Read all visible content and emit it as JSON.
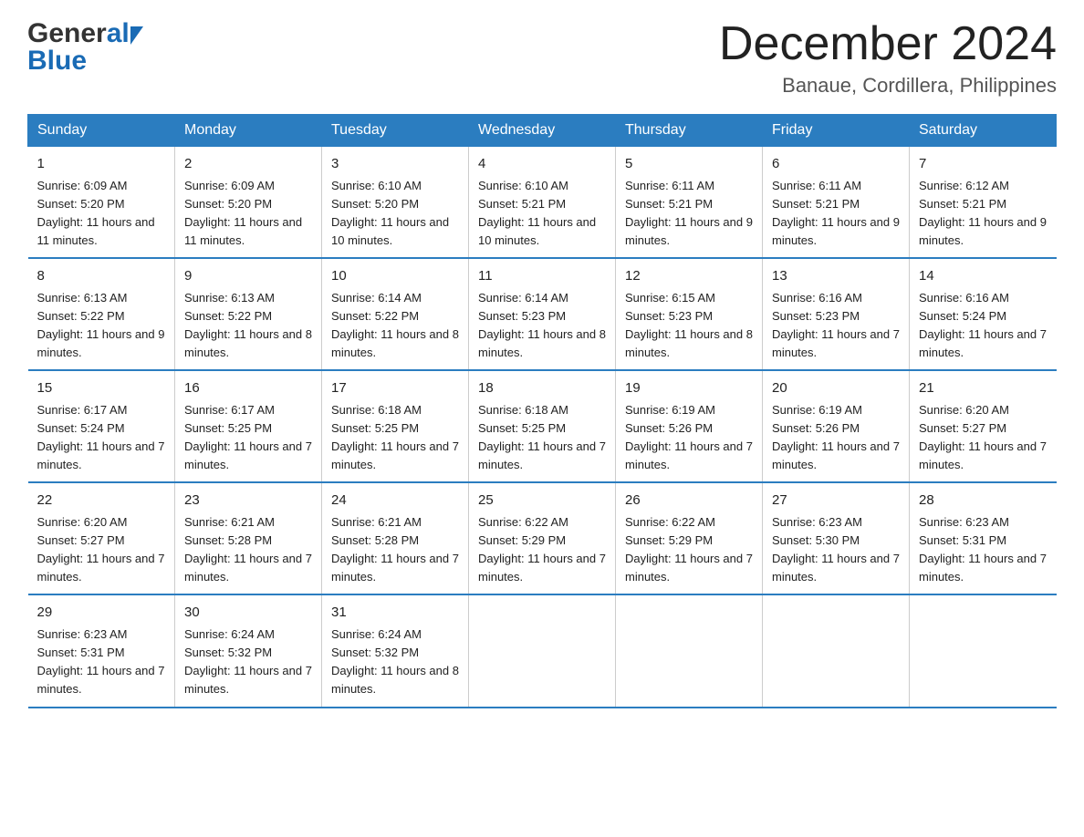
{
  "logo": {
    "general": "General",
    "blue": "Blue"
  },
  "title": "December 2024",
  "subtitle": "Banaue, Cordillera, Philippines",
  "days_of_week": [
    "Sunday",
    "Monday",
    "Tuesday",
    "Wednesday",
    "Thursday",
    "Friday",
    "Saturday"
  ],
  "weeks": [
    [
      {
        "num": "1",
        "sunrise": "6:09 AM",
        "sunset": "5:20 PM",
        "daylight": "11 hours and 11 minutes."
      },
      {
        "num": "2",
        "sunrise": "6:09 AM",
        "sunset": "5:20 PM",
        "daylight": "11 hours and 11 minutes."
      },
      {
        "num": "3",
        "sunrise": "6:10 AM",
        "sunset": "5:20 PM",
        "daylight": "11 hours and 10 minutes."
      },
      {
        "num": "4",
        "sunrise": "6:10 AM",
        "sunset": "5:21 PM",
        "daylight": "11 hours and 10 minutes."
      },
      {
        "num": "5",
        "sunrise": "6:11 AM",
        "sunset": "5:21 PM",
        "daylight": "11 hours and 9 minutes."
      },
      {
        "num": "6",
        "sunrise": "6:11 AM",
        "sunset": "5:21 PM",
        "daylight": "11 hours and 9 minutes."
      },
      {
        "num": "7",
        "sunrise": "6:12 AM",
        "sunset": "5:21 PM",
        "daylight": "11 hours and 9 minutes."
      }
    ],
    [
      {
        "num": "8",
        "sunrise": "6:13 AM",
        "sunset": "5:22 PM",
        "daylight": "11 hours and 9 minutes."
      },
      {
        "num": "9",
        "sunrise": "6:13 AM",
        "sunset": "5:22 PM",
        "daylight": "11 hours and 8 minutes."
      },
      {
        "num": "10",
        "sunrise": "6:14 AM",
        "sunset": "5:22 PM",
        "daylight": "11 hours and 8 minutes."
      },
      {
        "num": "11",
        "sunrise": "6:14 AM",
        "sunset": "5:23 PM",
        "daylight": "11 hours and 8 minutes."
      },
      {
        "num": "12",
        "sunrise": "6:15 AM",
        "sunset": "5:23 PM",
        "daylight": "11 hours and 8 minutes."
      },
      {
        "num": "13",
        "sunrise": "6:16 AM",
        "sunset": "5:23 PM",
        "daylight": "11 hours and 7 minutes."
      },
      {
        "num": "14",
        "sunrise": "6:16 AM",
        "sunset": "5:24 PM",
        "daylight": "11 hours and 7 minutes."
      }
    ],
    [
      {
        "num": "15",
        "sunrise": "6:17 AM",
        "sunset": "5:24 PM",
        "daylight": "11 hours and 7 minutes."
      },
      {
        "num": "16",
        "sunrise": "6:17 AM",
        "sunset": "5:25 PM",
        "daylight": "11 hours and 7 minutes."
      },
      {
        "num": "17",
        "sunrise": "6:18 AM",
        "sunset": "5:25 PM",
        "daylight": "11 hours and 7 minutes."
      },
      {
        "num": "18",
        "sunrise": "6:18 AM",
        "sunset": "5:25 PM",
        "daylight": "11 hours and 7 minutes."
      },
      {
        "num": "19",
        "sunrise": "6:19 AM",
        "sunset": "5:26 PM",
        "daylight": "11 hours and 7 minutes."
      },
      {
        "num": "20",
        "sunrise": "6:19 AM",
        "sunset": "5:26 PM",
        "daylight": "11 hours and 7 minutes."
      },
      {
        "num": "21",
        "sunrise": "6:20 AM",
        "sunset": "5:27 PM",
        "daylight": "11 hours and 7 minutes."
      }
    ],
    [
      {
        "num": "22",
        "sunrise": "6:20 AM",
        "sunset": "5:27 PM",
        "daylight": "11 hours and 7 minutes."
      },
      {
        "num": "23",
        "sunrise": "6:21 AM",
        "sunset": "5:28 PM",
        "daylight": "11 hours and 7 minutes."
      },
      {
        "num": "24",
        "sunrise": "6:21 AM",
        "sunset": "5:28 PM",
        "daylight": "11 hours and 7 minutes."
      },
      {
        "num": "25",
        "sunrise": "6:22 AM",
        "sunset": "5:29 PM",
        "daylight": "11 hours and 7 minutes."
      },
      {
        "num": "26",
        "sunrise": "6:22 AM",
        "sunset": "5:29 PM",
        "daylight": "11 hours and 7 minutes."
      },
      {
        "num": "27",
        "sunrise": "6:23 AM",
        "sunset": "5:30 PM",
        "daylight": "11 hours and 7 minutes."
      },
      {
        "num": "28",
        "sunrise": "6:23 AM",
        "sunset": "5:31 PM",
        "daylight": "11 hours and 7 minutes."
      }
    ],
    [
      {
        "num": "29",
        "sunrise": "6:23 AM",
        "sunset": "5:31 PM",
        "daylight": "11 hours and 7 minutes."
      },
      {
        "num": "30",
        "sunrise": "6:24 AM",
        "sunset": "5:32 PM",
        "daylight": "11 hours and 7 minutes."
      },
      {
        "num": "31",
        "sunrise": "6:24 AM",
        "sunset": "5:32 PM",
        "daylight": "11 hours and 8 minutes."
      },
      null,
      null,
      null,
      null
    ]
  ]
}
